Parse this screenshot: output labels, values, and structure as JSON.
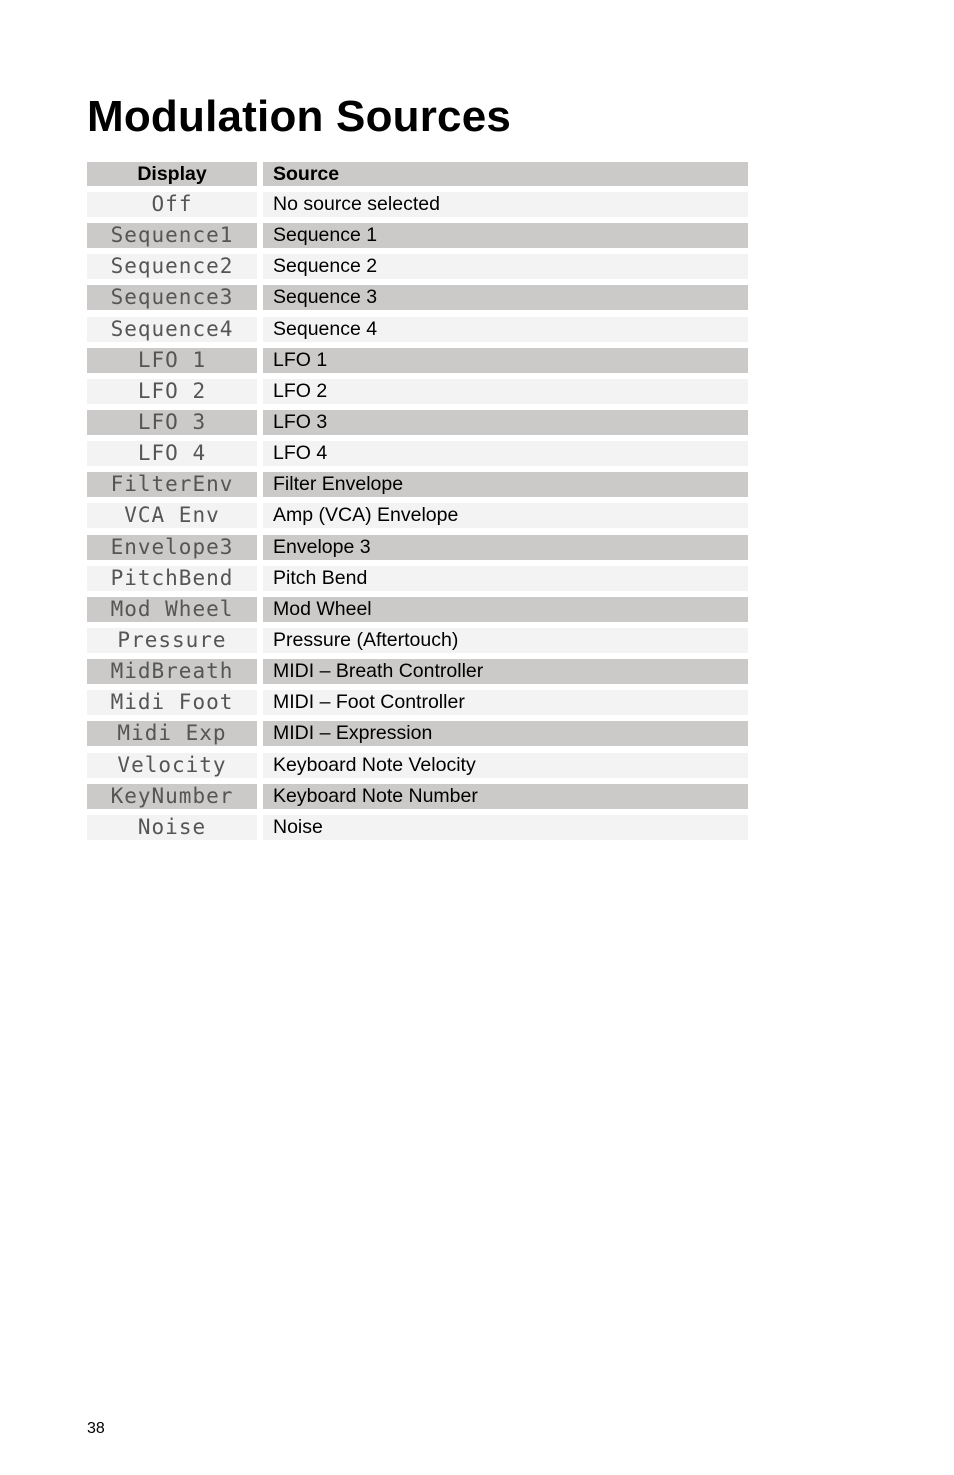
{
  "page": {
    "title": "Modulation Sources",
    "page_number": "38"
  },
  "table": {
    "headers": {
      "display": "Display",
      "source": "Source"
    },
    "rows": [
      {
        "display": "Off",
        "source": "No source selected"
      },
      {
        "display": "Sequence1",
        "source": "Sequence 1"
      },
      {
        "display": "Sequence2",
        "source": "Sequence 2"
      },
      {
        "display": "Sequence3",
        "source": "Sequence 3"
      },
      {
        "display": "Sequence4",
        "source": "Sequence 4"
      },
      {
        "display": "LFO 1",
        "source": "LFO 1"
      },
      {
        "display": "LFO 2",
        "source": "LFO 2"
      },
      {
        "display": "LFO 3",
        "source": "LFO 3"
      },
      {
        "display": "LFO 4",
        "source": "LFO 4"
      },
      {
        "display": "FilterEnv",
        "source": "Filter Envelope"
      },
      {
        "display": "VCA Env",
        "source": "Amp (VCA) Envelope"
      },
      {
        "display": "Envelope3",
        "source": "Envelope 3"
      },
      {
        "display": "PitchBend",
        "source": "Pitch Bend"
      },
      {
        "display": "Mod Wheel",
        "source": "Mod Wheel"
      },
      {
        "display": "Pressure",
        "source": "Pressure (Aftertouch)"
      },
      {
        "display": "MidBreath",
        "source": "MIDI – Breath Controller"
      },
      {
        "display": "Midi Foot",
        "source": "MIDI – Foot Controller"
      },
      {
        "display": "Midi Exp",
        "source": "MIDI – Expression"
      },
      {
        "display": "Velocity",
        "source": "Keyboard Note Velocity"
      },
      {
        "display": "KeyNumber",
        "source": "Keyboard Note Number"
      },
      {
        "display": "Noise",
        "source": "Noise"
      }
    ]
  }
}
